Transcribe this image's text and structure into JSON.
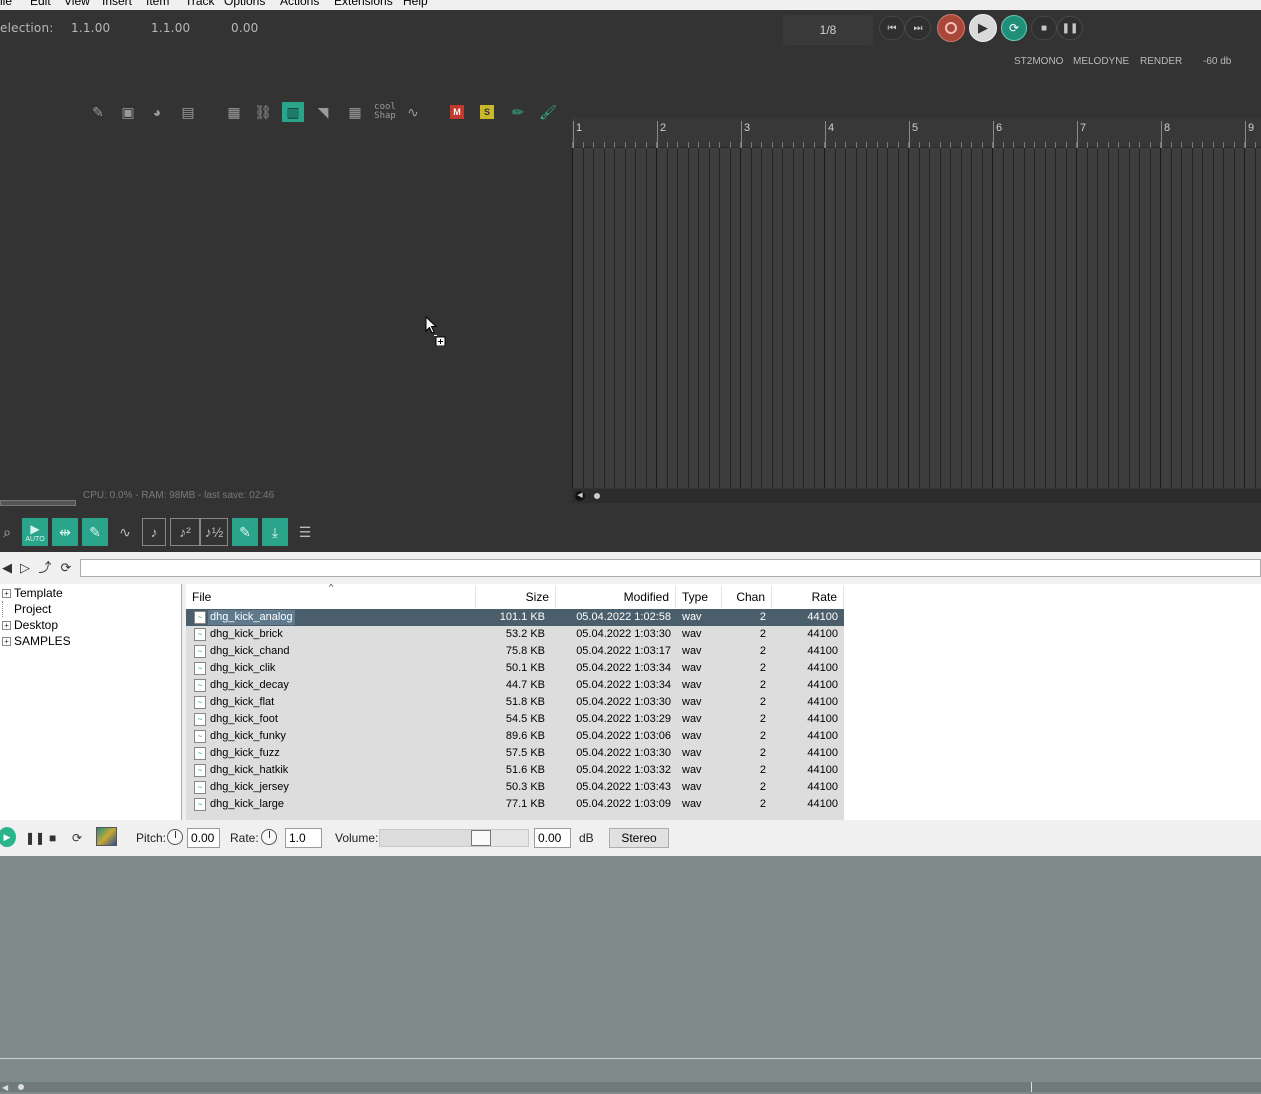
{
  "menu": [
    "ile",
    "Edit",
    "View",
    "Insert",
    "Item",
    "Track",
    "Options",
    "Actions",
    "Extensions",
    "Help"
  ],
  "selection": {
    "label": "election:",
    "start": "1.1.00",
    "end": "1.1.00",
    "length": "0.00"
  },
  "transport": {
    "meter": "1/8"
  },
  "top_buttons": {
    "st2mono": "ST2MONO",
    "melodyne": "MELODYNE",
    "render": "RENDER",
    "db": "-60 db"
  },
  "toolbar": {
    "cool_shap": "cool Shap"
  },
  "ruler": {
    "bars": [
      "1",
      "2",
      "3",
      "4",
      "5",
      "6",
      "7",
      "8",
      "9"
    ]
  },
  "status": "CPU: 0.0% - RAM: 98MB - last save: 02:46",
  "mx_toolbar": {
    "auto_label": "AUTO"
  },
  "browser": {
    "path": "",
    "tree": [
      {
        "label": "Template",
        "expandable": true
      },
      {
        "label": "Project",
        "expandable": false
      },
      {
        "label": "Desktop",
        "expandable": true
      },
      {
        "label": "SAMPLES",
        "expandable": true
      }
    ],
    "columns": {
      "file": "File",
      "size": "Size",
      "modified": "Modified",
      "type": "Type",
      "chan": "Chan",
      "rate": "Rate"
    },
    "rows": [
      {
        "name": "dhg_kick_analog",
        "size": "101.1 KB",
        "modified": "05.04.2022 1:02:58",
        "type": "wav",
        "chan": "2",
        "rate": "44100",
        "selected": true
      },
      {
        "name": "dhg_kick_brick",
        "size": "53.2 KB",
        "modified": "05.04.2022 1:03:30",
        "type": "wav",
        "chan": "2",
        "rate": "44100"
      },
      {
        "name": "dhg_kick_chand",
        "size": "75.8 KB",
        "modified": "05.04.2022 1:03:17",
        "type": "wav",
        "chan": "2",
        "rate": "44100"
      },
      {
        "name": "dhg_kick_clik",
        "size": "50.1 KB",
        "modified": "05.04.2022 1:03:34",
        "type": "wav",
        "chan": "2",
        "rate": "44100"
      },
      {
        "name": "dhg_kick_decay",
        "size": "44.7 KB",
        "modified": "05.04.2022 1:03:34",
        "type": "wav",
        "chan": "2",
        "rate": "44100"
      },
      {
        "name": "dhg_kick_flat",
        "size": "51.8 KB",
        "modified": "05.04.2022 1:03:30",
        "type": "wav",
        "chan": "2",
        "rate": "44100"
      },
      {
        "name": "dhg_kick_foot",
        "size": "54.5 KB",
        "modified": "05.04.2022 1:03:29",
        "type": "wav",
        "chan": "2",
        "rate": "44100"
      },
      {
        "name": "dhg_kick_funky",
        "size": "89.6 KB",
        "modified": "05.04.2022 1:03:06",
        "type": "wav",
        "chan": "2",
        "rate": "44100"
      },
      {
        "name": "dhg_kick_fuzz",
        "size": "57.5 KB",
        "modified": "05.04.2022 1:03:30",
        "type": "wav",
        "chan": "2",
        "rate": "44100"
      },
      {
        "name": "dhg_kick_hatkik",
        "size": "51.6 KB",
        "modified": "05.04.2022 1:03:32",
        "type": "wav",
        "chan": "2",
        "rate": "44100"
      },
      {
        "name": "dhg_kick_jersey",
        "size": "50.3 KB",
        "modified": "05.04.2022 1:03:43",
        "type": "wav",
        "chan": "2",
        "rate": "44100"
      },
      {
        "name": "dhg_kick_large",
        "size": "77.1 KB",
        "modified": "05.04.2022 1:03:09",
        "type": "wav",
        "chan": "2",
        "rate": "44100"
      }
    ]
  },
  "preview": {
    "pitch_label": "Pitch:",
    "pitch_value": "0.00",
    "rate_label": "Rate:",
    "rate_value": "1.0",
    "volume_label": "Volume:",
    "volume_value": "0.00",
    "volume_unit": "dB",
    "volume_level": 0.68,
    "stereo": "Stereo"
  },
  "colors": {
    "accent": "#2aa48a",
    "selection": "#4b5e6b",
    "record": "#c0392b"
  }
}
